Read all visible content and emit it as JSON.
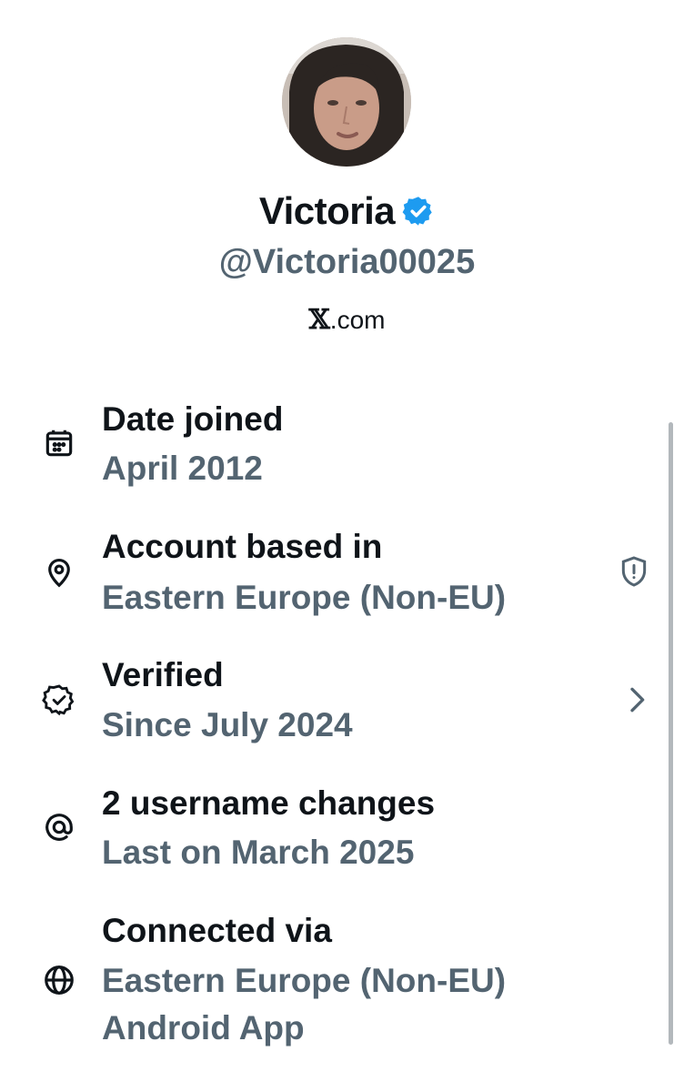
{
  "profile": {
    "display_name": "Victoria",
    "handle": "@Victoria00025",
    "source_prefix": "𝕏",
    "source_suffix": ".com",
    "verified": true,
    "avatar_icon": "user-avatar-photo",
    "badge_color": "#1d9bf0"
  },
  "about": {
    "items": [
      {
        "icon": "calendar-icon",
        "title": "Date joined",
        "value": "April 2012"
      },
      {
        "icon": "location-pin-icon",
        "title": "Account based in",
        "value": "Eastern Europe (Non-EU)",
        "trailing_icon": "shield-alert-icon"
      },
      {
        "icon": "verified-badge-outline-icon",
        "title": "Verified",
        "value": "Since July 2024",
        "trailing_icon": "chevron-right-icon"
      },
      {
        "icon": "at-sign-icon",
        "title": "2 username changes",
        "value": "Last on March 2025"
      },
      {
        "icon": "globe-icon",
        "title": "Connected via",
        "value": "Eastern Europe (Non-EU)",
        "value_2": "Android App"
      }
    ]
  },
  "colors": {
    "primary_text": "#0f1419",
    "secondary_text": "#536471",
    "accent": "#1d9bf0",
    "background": "#ffffff"
  }
}
